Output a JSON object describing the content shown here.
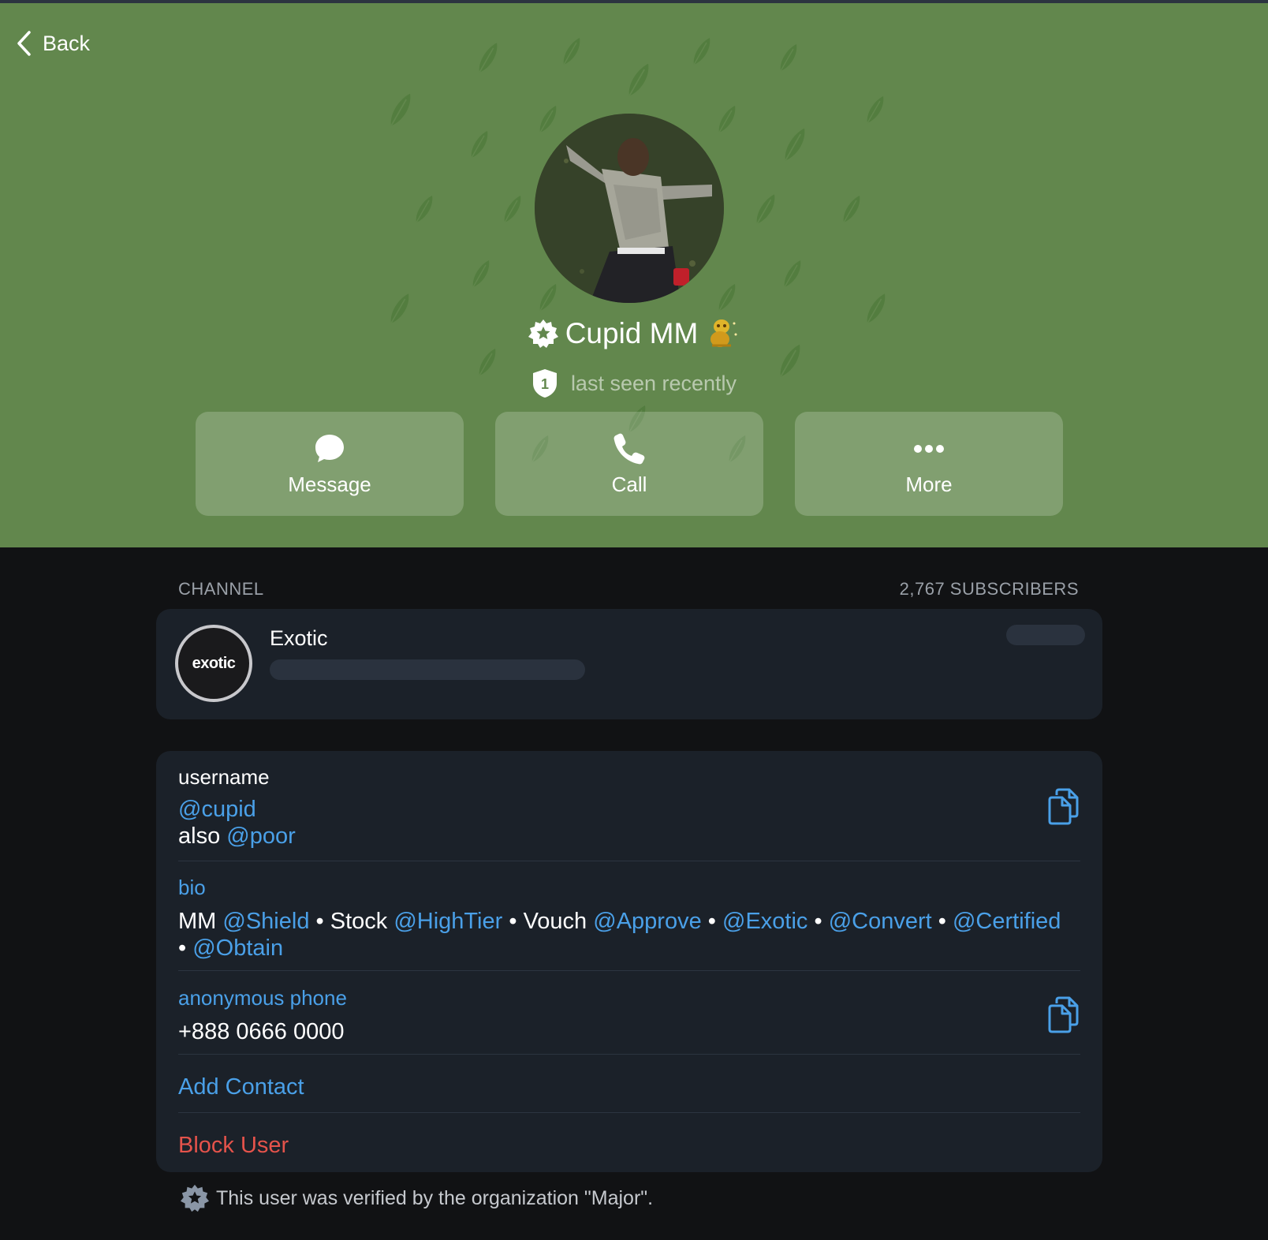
{
  "header": {
    "back_label": "Back",
    "background_color": "#62874d",
    "profile": {
      "name": "Cupid MM",
      "status": "last seen recently",
      "shield_number": "1",
      "verified_icon": "verified-star-badge",
      "emoji_icon": "golden-emoji-status"
    },
    "actions": [
      {
        "label": "Message",
        "icon": "message-bubble-icon"
      },
      {
        "label": "Call",
        "icon": "phone-icon"
      },
      {
        "label": "More",
        "icon": "more-dots-icon"
      }
    ]
  },
  "channel": {
    "section_label": "CHANNEL",
    "subscribers": "2,767 SUBSCRIBERS",
    "name": "Exotic",
    "avatar_text": "exotic"
  },
  "info": {
    "username_label": "username",
    "username": "@cupid",
    "also_prefix": "also",
    "also_username": "@poor",
    "bio_label": "bio",
    "bio": {
      "mm_prefix": "MM",
      "shield": "@Shield",
      "stock_prefix": "Stock",
      "hightier": "@HighTier",
      "vouch_prefix": "Vouch",
      "approve": "@Approve",
      "exotic": "@Exotic",
      "convert": "@Convert",
      "certified": "@Certified",
      "obtain": "@Obtain",
      "separator": "•"
    },
    "phone_label": "anonymous phone",
    "phone": "+888 0666 0000",
    "add_contact": "Add Contact",
    "block_user": "Block User"
  },
  "footer": {
    "verified_note": "This user was verified by the organization \"Major\"."
  },
  "colors": {
    "link": "#4aa0e8",
    "danger": "#e5534b",
    "card": "#1b2129",
    "page": "#111214"
  }
}
